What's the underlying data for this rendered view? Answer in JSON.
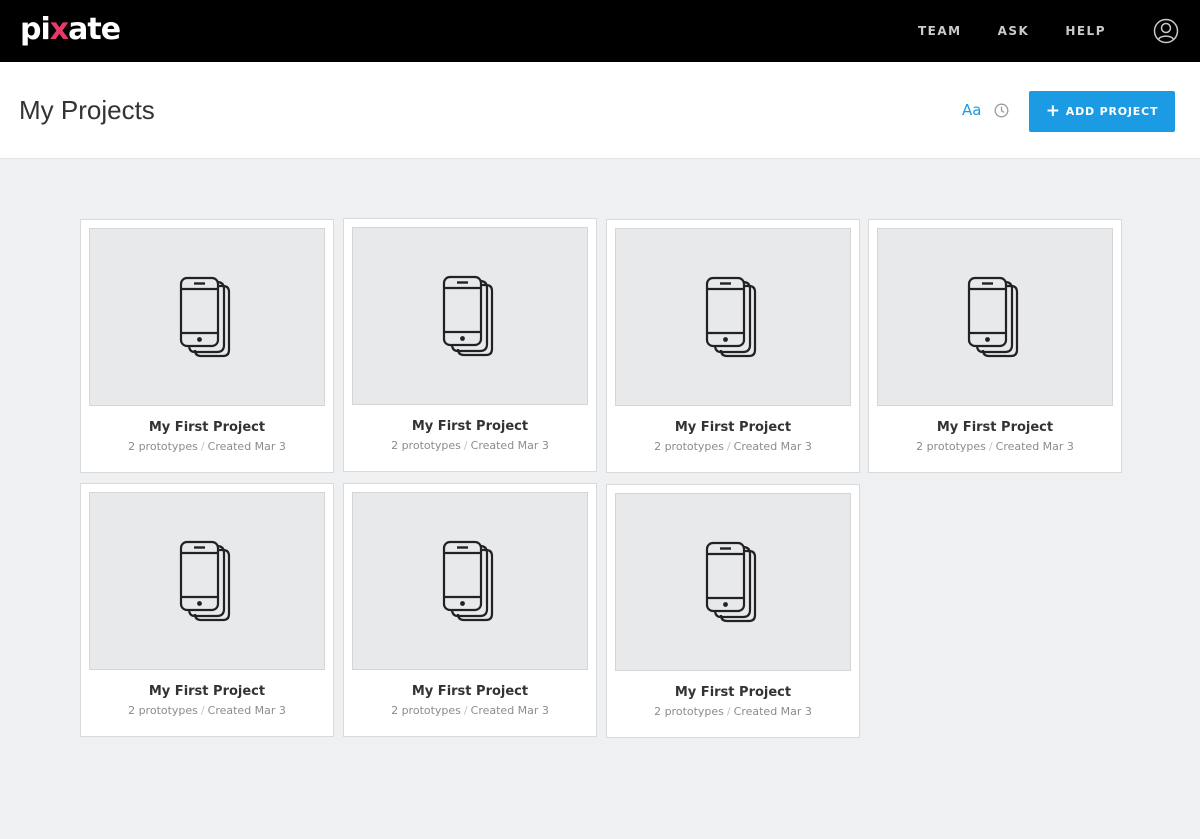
{
  "app": {
    "logo_parts": [
      "pi",
      "x",
      "a",
      "te"
    ],
    "logo_text": "pixate"
  },
  "nav": {
    "items": [
      {
        "label": "TEAM"
      },
      {
        "label": "ASK"
      },
      {
        "label": "HELP"
      }
    ],
    "user_icon": "user-circle-icon"
  },
  "header": {
    "title": "My Projects",
    "font_toggle": "Aa",
    "clock_icon": "clock-icon",
    "add_button": {
      "icon": "+",
      "label": "ADD PROJECT"
    }
  },
  "projects": [
    {
      "title": "My First Project",
      "prototypes": "2 prototypes",
      "separator": "/",
      "created": "Created Mar 3",
      "icon": "phone-stack-icon"
    },
    {
      "title": "My First Project",
      "prototypes": "2 prototypes",
      "separator": "/",
      "created": "Created Mar 3",
      "icon": "phone-stack-icon"
    },
    {
      "title": "My First Project",
      "prototypes": "2 prototypes",
      "separator": "/",
      "created": "Created Mar 3",
      "icon": "phone-stack-icon"
    },
    {
      "title": "My First Project",
      "prototypes": "2 prototypes",
      "separator": "/",
      "created": "Created Mar 3",
      "icon": "phone-stack-icon"
    },
    {
      "title": "My First Project",
      "prototypes": "2 prototypes",
      "separator": "/",
      "created": "Created Mar 3",
      "icon": "phone-stack-icon"
    },
    {
      "title": "My First Project",
      "prototypes": "2 prototypes",
      "separator": "/",
      "created": "Created Mar 3",
      "icon": "phone-stack-icon"
    },
    {
      "title": "My First Project",
      "prototypes": "2 prototypes",
      "separator": "/",
      "created": "Created Mar 3",
      "icon": "phone-stack-icon"
    }
  ],
  "colors": {
    "accent": "#1a9be3",
    "topbar": "#000000",
    "logo_x_pink": "#e8396b",
    "logo_x_blue": "#2ba8e6"
  }
}
